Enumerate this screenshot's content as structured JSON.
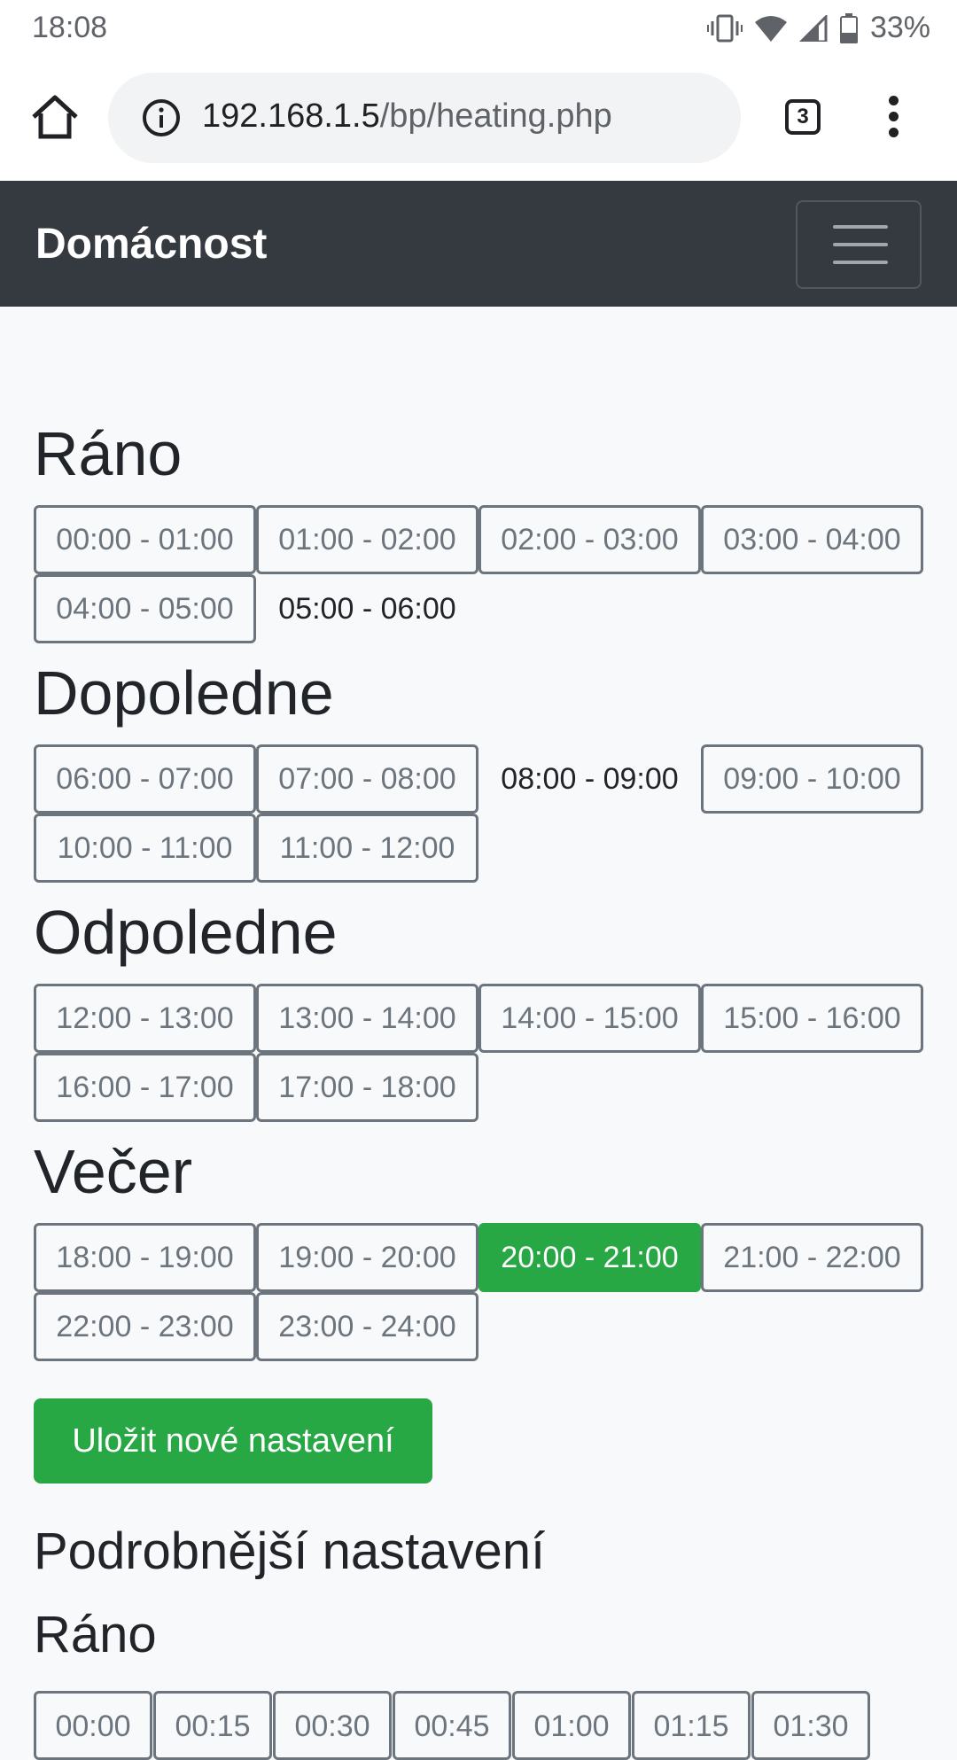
{
  "status_bar": {
    "time": "18:08",
    "battery": "33%"
  },
  "browser": {
    "url_host": "192.168.1.5",
    "url_path": "/bp/heating.php",
    "tab_count": "3"
  },
  "navbar": {
    "brand": "Domácnost"
  },
  "sections": [
    {
      "title": "Ráno",
      "slots": [
        {
          "label": "00:00 - 01:00",
          "state": "off"
        },
        {
          "label": "01:00 - 02:00",
          "state": "off"
        },
        {
          "label": "02:00 - 03:00",
          "state": "off"
        },
        {
          "label": "03:00 - 04:00",
          "state": "off"
        },
        {
          "label": "04:00 - 05:00",
          "state": "off"
        },
        {
          "label": "05:00 - 06:00",
          "state": "blank"
        }
      ]
    },
    {
      "title": "Dopoledne",
      "slots": [
        {
          "label": "06:00 - 07:00",
          "state": "off"
        },
        {
          "label": "07:00 - 08:00",
          "state": "off"
        },
        {
          "label": "08:00 - 09:00",
          "state": "blank"
        },
        {
          "label": "09:00 - 10:00",
          "state": "off"
        },
        {
          "label": "10:00 - 11:00",
          "state": "off"
        },
        {
          "label": "11:00 - 12:00",
          "state": "off"
        }
      ]
    },
    {
      "title": "Odpoledne",
      "slots": [
        {
          "label": "12:00 - 13:00",
          "state": "off"
        },
        {
          "label": "13:00 - 14:00",
          "state": "off"
        },
        {
          "label": "14:00 - 15:00",
          "state": "off"
        },
        {
          "label": "15:00 - 16:00",
          "state": "off"
        },
        {
          "label": "16:00 - 17:00",
          "state": "off"
        },
        {
          "label": "17:00 - 18:00",
          "state": "off"
        }
      ]
    },
    {
      "title": "Večer",
      "slots": [
        {
          "label": "18:00 - 19:00",
          "state": "off"
        },
        {
          "label": "19:00 - 20:00",
          "state": "off"
        },
        {
          "label": "20:00 - 21:00",
          "state": "on"
        },
        {
          "label": "21:00 - 22:00",
          "state": "off"
        },
        {
          "label": "22:00 - 23:00",
          "state": "off"
        },
        {
          "label": "23:00 - 24:00",
          "state": "off"
        }
      ]
    }
  ],
  "save_button": "Uložit nové nastavení",
  "detail": {
    "title": "Podrobnější nastavení",
    "section_title": "Ráno",
    "slots": [
      "00:00",
      "00:15",
      "00:30",
      "00:45",
      "01:00",
      "01:15",
      "01:30"
    ]
  },
  "colors": {
    "navbar": "#343a40",
    "success": "#28a745",
    "slot_border": "#6c757d"
  }
}
